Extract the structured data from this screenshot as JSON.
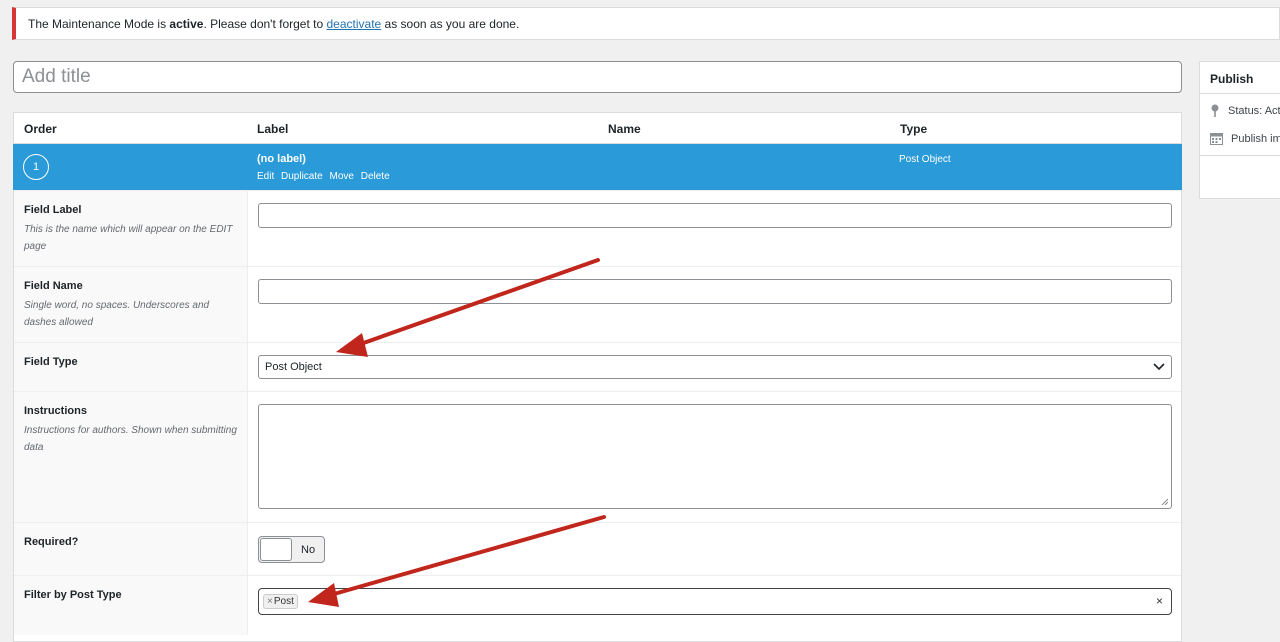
{
  "notice": {
    "text_before": "The Maintenance Mode is ",
    "active_word": "active",
    "text_middle": ". Please don't forget to ",
    "link_text": "deactivate",
    "text_after": " as soon as you are done."
  },
  "title_placeholder": "Add title",
  "publish": {
    "heading": "Publish",
    "status_text": "Status: Act",
    "publish_text": "Publish im"
  },
  "table": {
    "headers": {
      "order": "Order",
      "label": "Label",
      "name": "Name",
      "type": "Type"
    },
    "field": {
      "order": "1",
      "label": "(no label)",
      "actions": [
        "Edit",
        "Duplicate",
        "Move",
        "Delete"
      ],
      "type": "Post Object"
    }
  },
  "settings": {
    "field_label": {
      "title": "Field Label",
      "desc": "This is the name which will appear on the EDIT page"
    },
    "field_name": {
      "title": "Field Name",
      "desc": "Single word, no spaces. Underscores and dashes allowed"
    },
    "field_type": {
      "title": "Field Type",
      "value": "Post Object"
    },
    "instructions": {
      "title": "Instructions",
      "desc": "Instructions for authors. Shown when submitting data"
    },
    "required": {
      "title": "Required?",
      "toggle_label": "No"
    },
    "filter_post_type": {
      "title": "Filter by Post Type",
      "chip_remove": "×",
      "chip": "Post",
      "clear": "×"
    }
  },
  "colors": {
    "accent": "#2a9ad9",
    "notice_border": "#d63638",
    "arrow": "#c0261b"
  }
}
